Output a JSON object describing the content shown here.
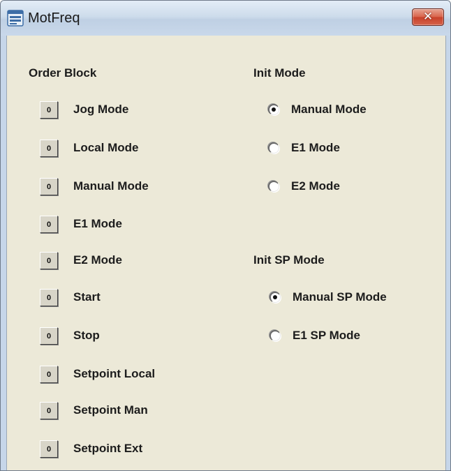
{
  "window": {
    "title": "MotFreq",
    "close_label": "✕"
  },
  "order_block": {
    "heading": "Order Block",
    "button_glyph": "0",
    "items": [
      {
        "label": "Jog Mode"
      },
      {
        "label": "Local Mode"
      },
      {
        "label": "Manual Mode"
      },
      {
        "label": "E1 Mode"
      },
      {
        "label": "E2 Mode"
      },
      {
        "label": "Start"
      },
      {
        "label": "Stop"
      },
      {
        "label": "Setpoint Local"
      },
      {
        "label": "Setpoint Man"
      },
      {
        "label": "Setpoint Ext"
      }
    ]
  },
  "init_mode": {
    "heading": "Init Mode",
    "options": [
      {
        "label": "Manual Mode",
        "selected": true
      },
      {
        "label": "E1 Mode",
        "selected": false
      },
      {
        "label": "E2 Mode",
        "selected": false
      }
    ]
  },
  "init_sp_mode": {
    "heading": "Init SP Mode",
    "options": [
      {
        "label": "Manual SP Mode",
        "selected": true
      },
      {
        "label": "E1 SP Mode",
        "selected": false
      }
    ]
  },
  "icons": {
    "app": "window-app-icon",
    "close": "close-icon"
  }
}
